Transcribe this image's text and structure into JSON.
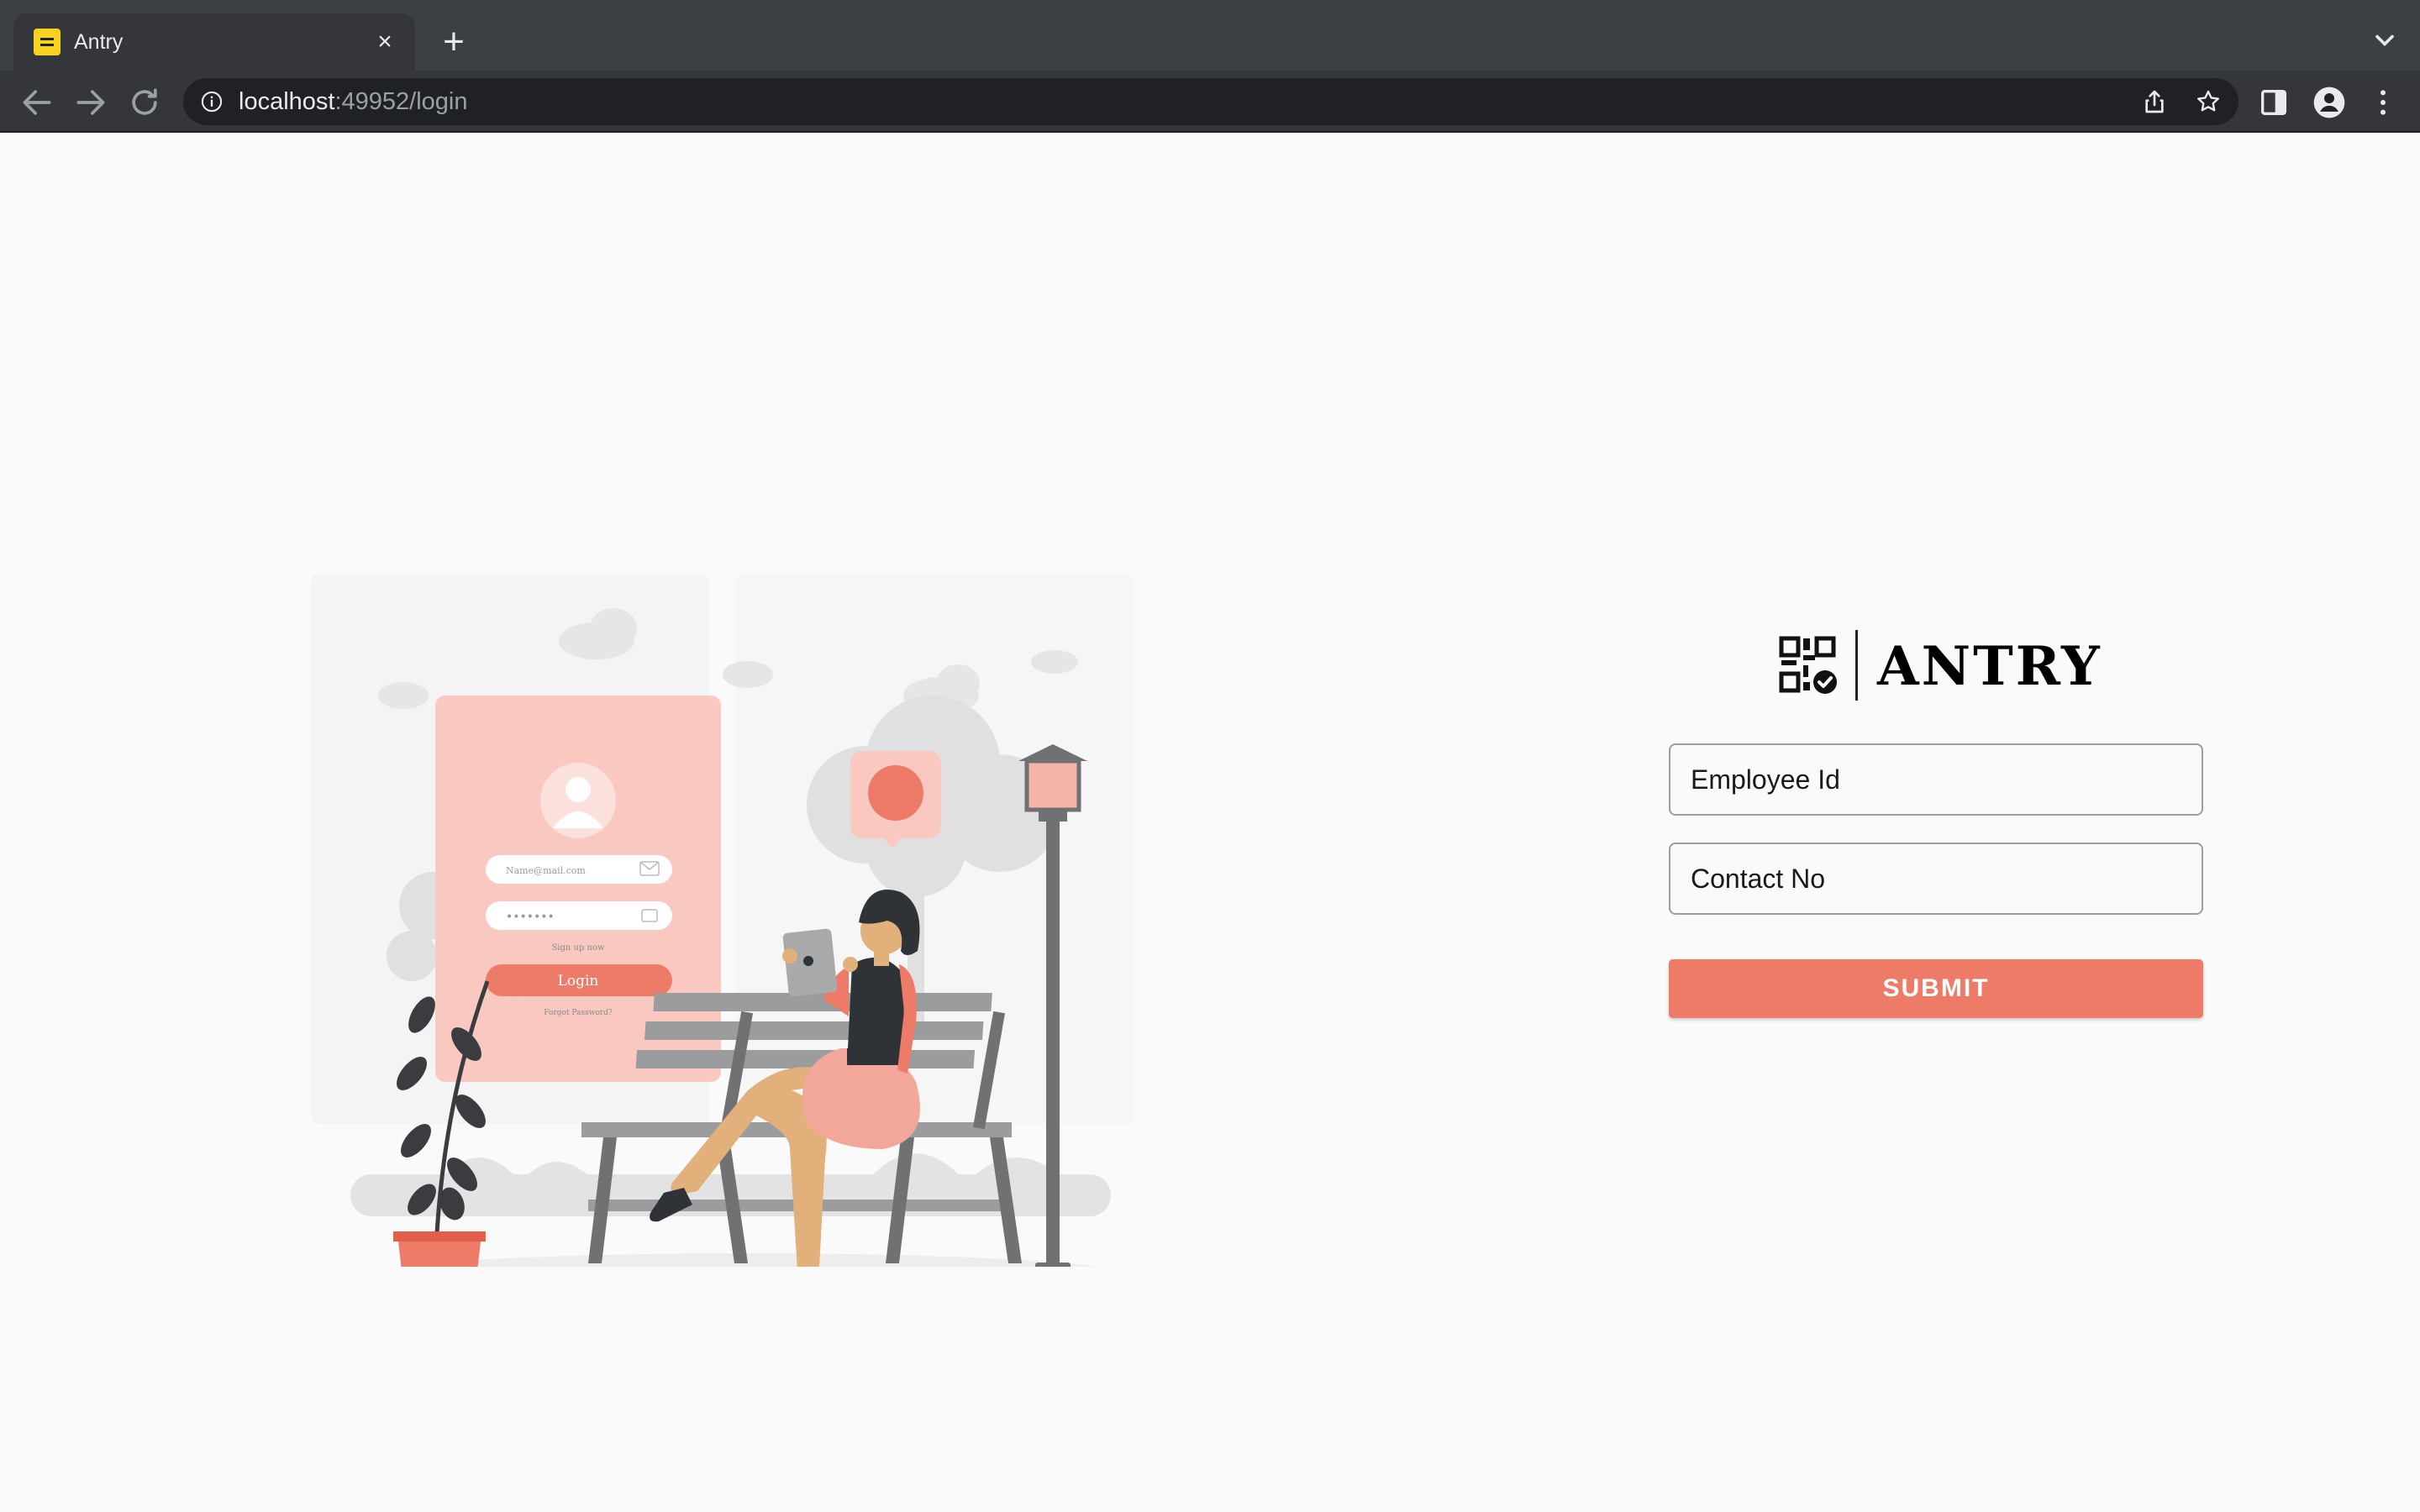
{
  "browser": {
    "tab_title": "Antry",
    "tab_close": "×",
    "new_tab": "+",
    "url_host": "localhost",
    "url_path": ":49952/login"
  },
  "brand": {
    "name": "ANTRY"
  },
  "form": {
    "employee_placeholder": "Employee Id",
    "contact_placeholder": "Contact No",
    "submit_label": "SUBMIT"
  },
  "illustration": {
    "email_placeholder": "Name@mail.com",
    "password_mask": "•••••••",
    "signup_link": "Sign up now",
    "login_label": "Login",
    "forgot_link": "Forgot Password?"
  },
  "colors": {
    "accent": "#ee7b67",
    "card_pink": "#f9c9c1",
    "chrome_dark": "#3c4043"
  },
  "icons": [
    "back-icon",
    "forward-icon",
    "reload-icon",
    "info-icon",
    "share-icon",
    "star-icon",
    "side-panel-icon",
    "profile-icon",
    "menu-icon",
    "qr-code-icon"
  ]
}
